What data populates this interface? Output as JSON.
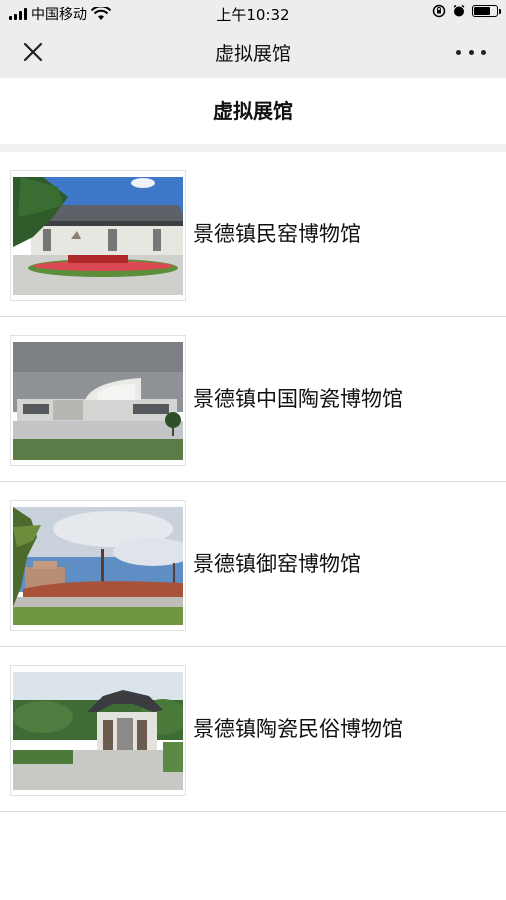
{
  "status_bar": {
    "carrier": "中国移动",
    "time": "上午10:32",
    "battery_level": 0.8
  },
  "nav_bar": {
    "title": "虚拟展馆",
    "close_icon": "close-icon",
    "more_icon": "more-icon"
  },
  "page": {
    "header": "虚拟展馆"
  },
  "museums": [
    {
      "name": "景德镇民窑博物馆"
    },
    {
      "name": "景德镇中国陶瓷博物馆"
    },
    {
      "name": "景德镇御窑博物馆"
    },
    {
      "name": "景德镇陶瓷民俗博物馆"
    }
  ]
}
